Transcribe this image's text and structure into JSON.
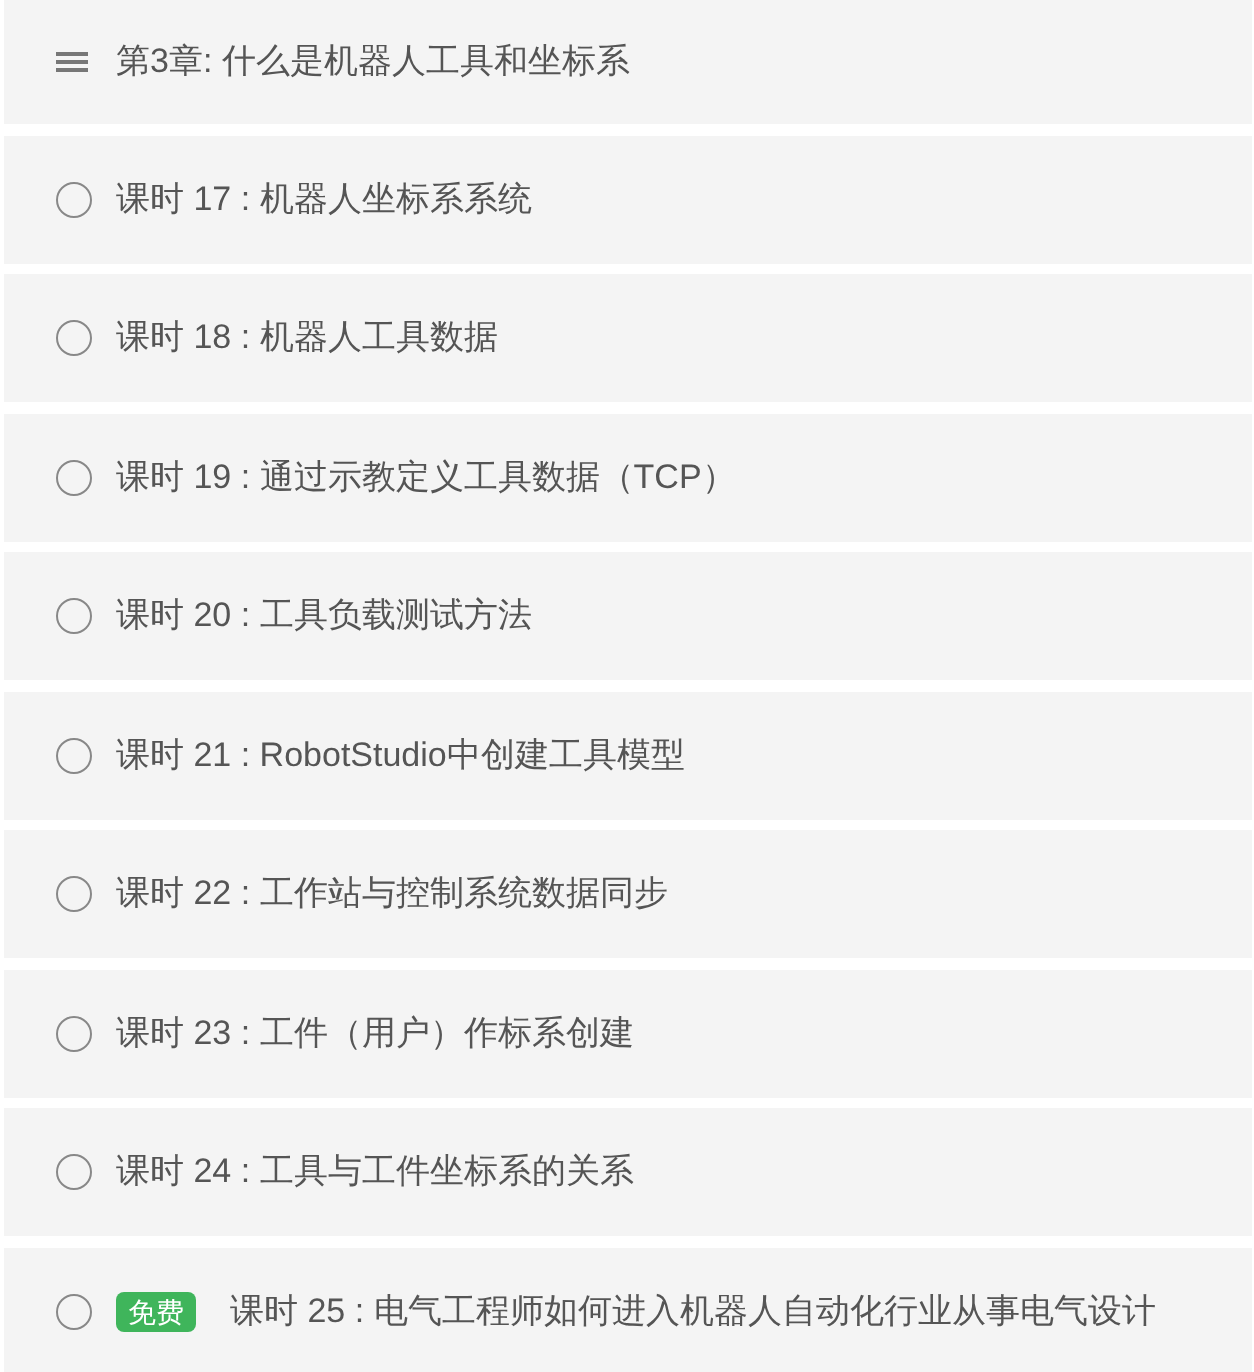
{
  "chapter": {
    "title": "第3章: 什么是机器人工具和坐标系"
  },
  "lessons": [
    {
      "label": "课时 17 : 机器人坐标系系统"
    },
    {
      "label": "课时 18 : 机器人工具数据"
    },
    {
      "label": "课时 19 : 通过示教定义工具数据（TCP）"
    },
    {
      "label": "课时 20 : 工具负载测试方法"
    },
    {
      "label": "课时 21 : RobotStudio中创建工具模型"
    },
    {
      "label": "课时 22 : 工作站与控制系统数据同步"
    },
    {
      "label": "课时 23 : 工件（用户）作标系创建"
    },
    {
      "label": "课时 24 : 工具与工件坐标系的关系"
    },
    {
      "label": "课时 25 : 电气工程师如何进入机器人自动化行业从事电气设计",
      "badge": "免费"
    }
  ]
}
